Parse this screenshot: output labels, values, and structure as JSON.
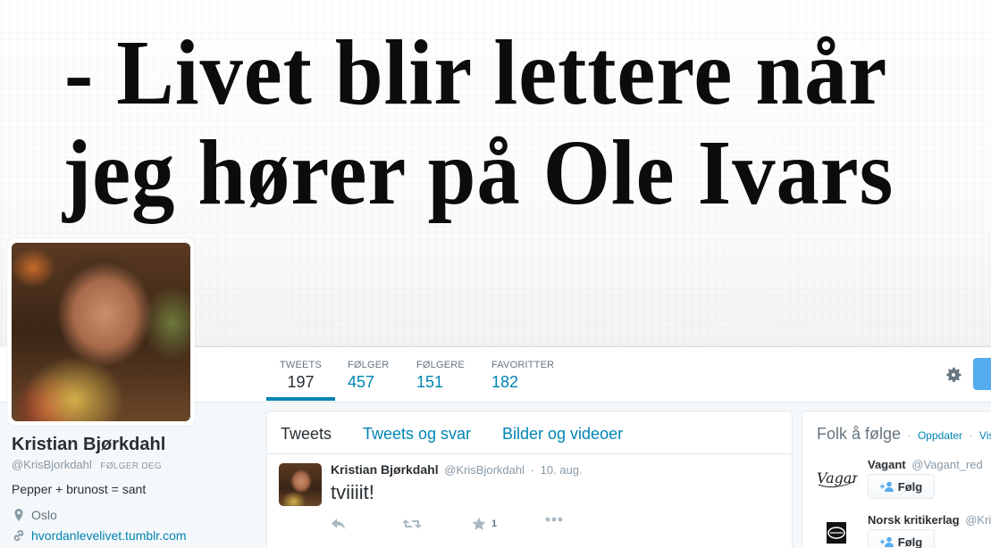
{
  "banner": {
    "line1": "- Livet blir lettere når",
    "line2": "jeg hører på Ole Ivars"
  },
  "nav": {
    "stats": [
      {
        "label": "TWEETS",
        "value": "197"
      },
      {
        "label": "FØLGER",
        "value": "457"
      },
      {
        "label": "FØLGERE",
        "value": "151"
      },
      {
        "label": "FAVORITTER",
        "value": "182"
      }
    ],
    "settings_icon": "gear-icon"
  },
  "profile": {
    "name": "Kristian Bjørkdahl",
    "handle": "@KrisBjorkdahl",
    "follows_you": "FØLGER DEG",
    "bio": "Pepper + brunost = sant",
    "location": "Oslo",
    "url": "hvordanlevelivet.tumblr.com"
  },
  "timeline": {
    "tabs": [
      "Tweets",
      "Tweets og svar",
      "Bilder og videoer"
    ],
    "tweet": {
      "fullname": "Kristian Bjørkdahl",
      "username": "@KrisBjorkdahl",
      "separator": "·",
      "time": "10. aug.",
      "text": "tviiiit!",
      "favorite_count": "1"
    }
  },
  "who_to_follow": {
    "title": "Folk å følge",
    "dot": "·",
    "refresh": "Oppdater",
    "view_all": "Vis alle",
    "items": [
      {
        "name": "Vagant",
        "handle": "@Vagant_red",
        "button": "Følg",
        "logo_text": "Vagant"
      },
      {
        "name": "Norsk kritikerlag",
        "handle": "@Kritikerlaget",
        "button": "Følg"
      }
    ]
  },
  "colors": {
    "link": "#0084b4",
    "text": "#292f33",
    "muted": "#8899a6",
    "background": "#f5f8fa"
  }
}
